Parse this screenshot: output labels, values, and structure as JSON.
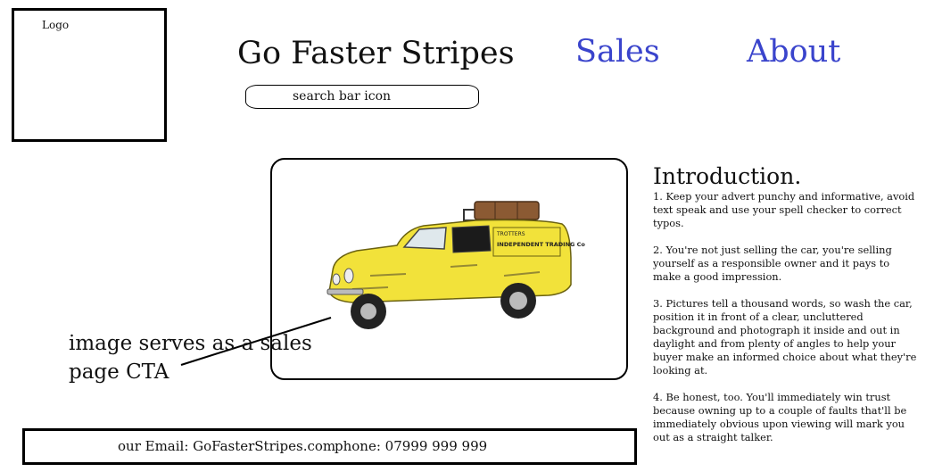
{
  "header": {
    "logo_label": "Logo",
    "site_title": "Go Faster Stripes",
    "nav": {
      "sales": "Sales",
      "about": "About"
    },
    "search_placeholder": "search bar icon"
  },
  "hero": {
    "image_alt": "yellow three-wheeler van",
    "van_text_line1": "TROTTERS",
    "van_text_line2": "INDEPENDENT TRADING Co"
  },
  "annotation": {
    "line1": "image serves as a sales",
    "line2": "page CTA"
  },
  "intro": {
    "heading": "Introduction.",
    "paragraphs": [
      "1. Keep your advert punchy and informative, avoid text speak and use your spell checker to correct typos.",
      "2. You're not just selling the car,  you're selling yourself as a responsible owner and it pays to make a good impression.",
      "3. Pictures tell a thousand words, so wash the car, position it in front of a clear, uncluttered background and photograph it inside and out in daylight and from plenty of angles to help your buyer make an informed choice about what they're looking at.",
      "4. Be honest, too. You'll immediately win trust because owning up to a couple of faults that'll be immediately obvious upon viewing will mark you out as a straight talker."
    ]
  },
  "footer": {
    "email": "our Email: GoFasterStripes.com",
    "phone": "phone: 07999 999 999"
  },
  "colors": {
    "nav_link": "#3a44cc",
    "van_body": "#f2e23a"
  }
}
